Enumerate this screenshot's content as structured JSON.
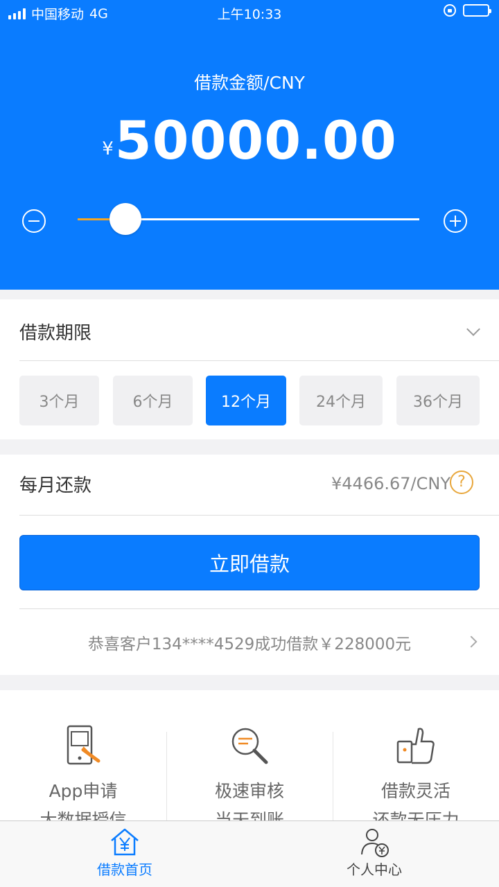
{
  "status_bar": {
    "carrier": "中国移动",
    "network": "4G",
    "time": "上午10:33"
  },
  "header": {
    "amount_label": "借款金额/CNY",
    "currency_symbol": "¥",
    "amount": "50000.00",
    "slider_fraction": 0.14,
    "slider_fill_color": "#f5a623",
    "background_color": "#0a7cff"
  },
  "term": {
    "title": "借款期限",
    "options": [
      "3个月",
      "6个月",
      "12个月",
      "24个月",
      "36个月"
    ],
    "selected": "12个月"
  },
  "payment": {
    "title": "每月还款",
    "value": "¥4466.67/CNY",
    "help": "?",
    "borrow_button": "立即借款",
    "notice": "恭喜客户134****4529成功借款￥228000元"
  },
  "features": [
    {
      "icon": "phone-touch-icon",
      "line1": "App申请",
      "line2": "大数据授信"
    },
    {
      "icon": "search-review-icon",
      "line1": "极速审核",
      "line2": "当天到账"
    },
    {
      "icon": "thumbs-up-icon",
      "line1": "借款灵活",
      "line2": "还款无压力"
    }
  ],
  "tabbar": {
    "home": "借款首页",
    "profile": "个人中心"
  }
}
